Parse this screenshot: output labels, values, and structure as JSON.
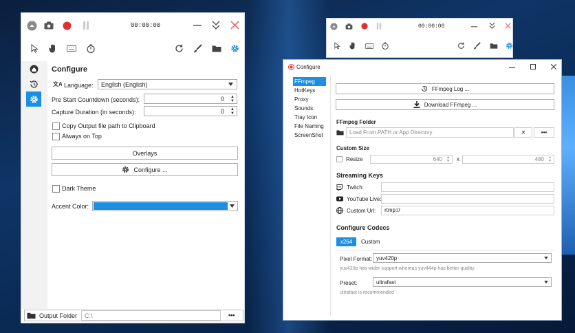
{
  "colors": {
    "accent": "#1d8fe0",
    "record_red": "#e03030",
    "close_red": "#f07070"
  },
  "left_window": {
    "timer": "00:00:00",
    "icons": {
      "status": "status-circle-icon",
      "screenshot": "camera-icon",
      "record": "record-icon",
      "pause": "pause-icon",
      "minimize": "minimize-icon",
      "collapse": "chevrons-down-icon",
      "close": "close-icon"
    },
    "panel_title": "Configure",
    "language_label": "Language:",
    "language_value": "English (English)",
    "pre_start_label": "Pre Start Countdown (seconds):",
    "pre_start_value": "0",
    "capture_label": "Capture Duration (in seconds):",
    "capture_value": "0",
    "copy_output_label": "Copy Output file path to Clipboard",
    "always_on_top_label": "Always on Top",
    "overlays_label": "Overlays",
    "configure_label": "Configure ...",
    "dark_theme_label": "Dark Theme",
    "accent_label": "Accent Color:",
    "output_folder_label": "Output Folder",
    "output_folder_value": "C:\\",
    "output_more": "•••"
  },
  "right_toolbar": {
    "timer": "00:00:00"
  },
  "config_window": {
    "title": "Configure",
    "nav": [
      "FFmpeg",
      "HotKeys",
      "Proxy",
      "Sounds",
      "Tray Icon",
      "File Naming",
      "ScreenShot"
    ],
    "ffmpeg_log_label": "FFmpeg Log ...",
    "download_label": "Download FFmpeg ...",
    "ffmpeg_folder_title": "FFmpeg Folder",
    "ffmpeg_folder_placeholder": "Load From PATH or App Directory",
    "clear_label": "✕",
    "more_label": "•••",
    "custom_size_title": "Custom Size",
    "resize_label": "Resize",
    "width_value": "640",
    "times": "x",
    "height_value": "480",
    "streaming_title": "Streaming Keys",
    "twitch_label": "Twitch:",
    "youtube_label": "YouTube Live:",
    "custom_url_label": "Custom Url:",
    "custom_url_value": "rtmp://",
    "codecs_title": "Configure Codecs",
    "codec_tabs": [
      "x264",
      "Custom"
    ],
    "pixel_format_label": "Pixel Format:",
    "pixel_format_value": "yuv420p",
    "pixel_note": "yuv420p has wider support whereas yuv444p has better quality",
    "preset_label": "Preset:",
    "preset_value": "ultrafast",
    "preset_note": "ultrafast is recommended"
  }
}
